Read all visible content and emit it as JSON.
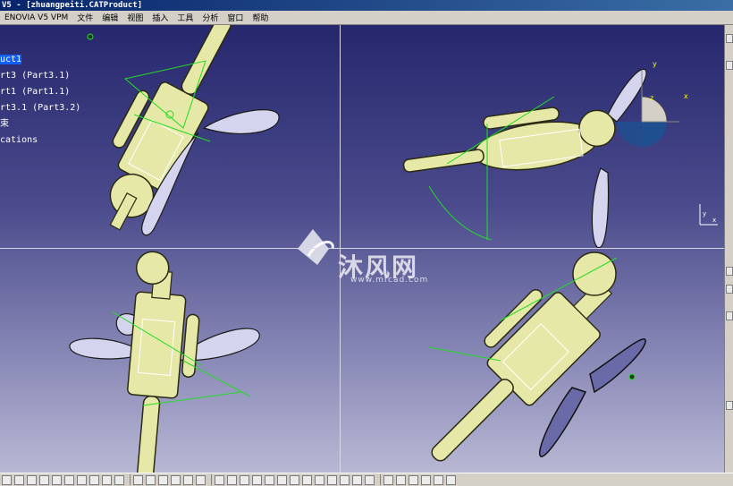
{
  "window": {
    "title": "V5 - [zhuangpeiti.CATProduct]"
  },
  "menu": {
    "items": [
      "ENOVIA V5 VPM",
      "文件",
      "编辑",
      "视图",
      "插入",
      "工具",
      "分析",
      "窗口",
      "帮助"
    ]
  },
  "tree": {
    "items": [
      "uct1",
      "rt3 (Part3.1)",
      "rt1 (Part1.1)",
      "rt3.1 (Part3.2)",
      "束",
      "cations"
    ]
  },
  "compass": {
    "x": "x",
    "y": "y",
    "z": "z"
  },
  "axis": {
    "x": "x",
    "y": "y"
  },
  "watermark": {
    "main": "沐风网",
    "sub": "www.mfcad.com"
  },
  "colors": {
    "part_fill": "#e6e8a8",
    "part_stroke": "#2a2a10",
    "fan_fill": "#d4d4ee",
    "constraint": "#22dd22",
    "workspace_top": "#27276e",
    "workspace_bottom": "#b8b8d4"
  }
}
